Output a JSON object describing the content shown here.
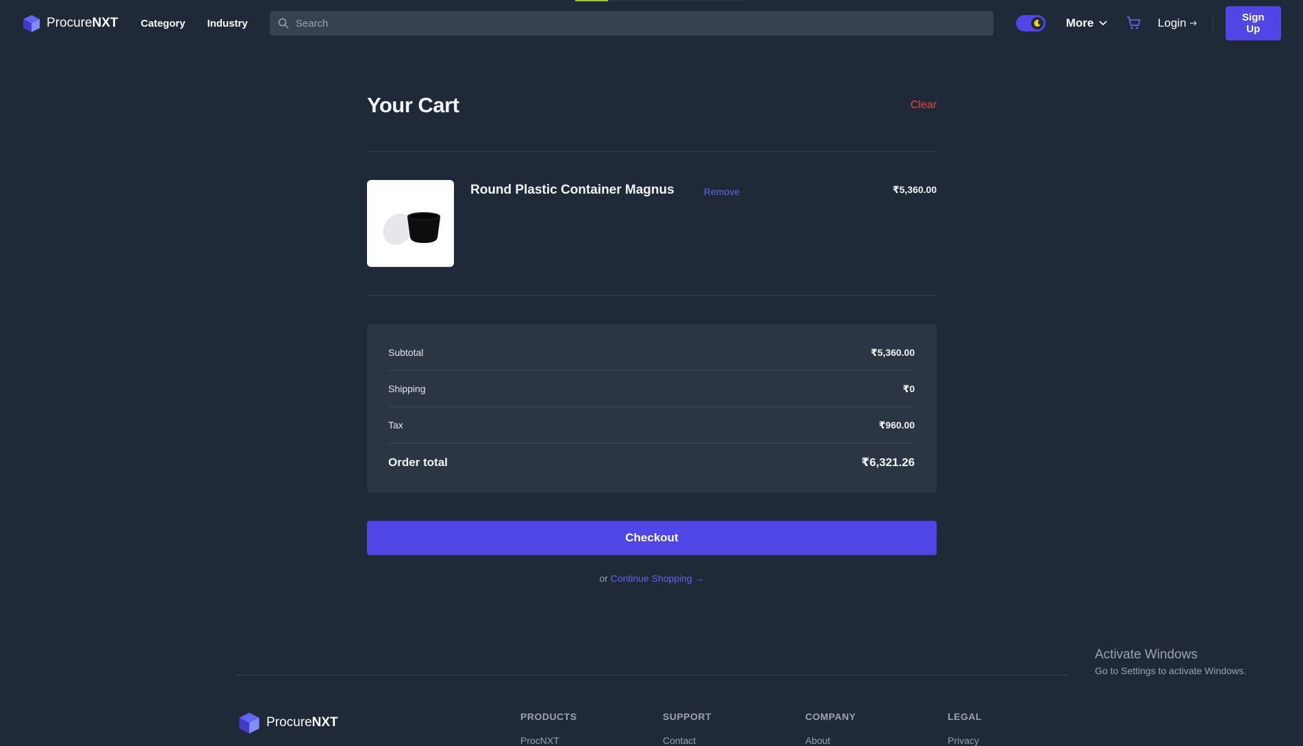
{
  "brand": {
    "name_regular": "Procure",
    "name_bold": "NXT"
  },
  "nav": {
    "items": [
      "Category",
      "Industry"
    ]
  },
  "search": {
    "placeholder": "Search"
  },
  "header": {
    "more_label": "More",
    "login_label": "Login",
    "signup_label": "Sign Up"
  },
  "cart": {
    "title": "Your Cart",
    "clear_label": "Clear",
    "items": [
      {
        "name": "Round Plastic Container Magnus",
        "remove_label": "Remove",
        "price": "₹5,360.00"
      }
    ]
  },
  "summary": {
    "subtotal_label": "Subtotal",
    "subtotal_value": "₹5,360.00",
    "shipping_label": "Shipping",
    "shipping_value": "₹0",
    "tax_label": "Tax",
    "tax_value": "₹960.00",
    "total_label": "Order total",
    "total_value": "₹6,321.26"
  },
  "checkout_label": "Checkout",
  "continue": {
    "prefix": "or",
    "link_label": "Continue Shopping →"
  },
  "watermark": {
    "line1": "Activate Windows",
    "line2": "Go to Settings to activate Windows."
  },
  "footer": {
    "columns": [
      {
        "title": "PRODUCTS",
        "first_link": "ProcNXT"
      },
      {
        "title": "SUPPORT",
        "first_link": "Contact"
      },
      {
        "title": "COMPANY",
        "first_link": "About"
      },
      {
        "title": "LEGAL",
        "first_link": "Privacy"
      }
    ]
  },
  "colors": {
    "accent": "#4f46e5",
    "danger": "#ef4444",
    "background": "#1f2937",
    "panel": "#2c3544"
  }
}
